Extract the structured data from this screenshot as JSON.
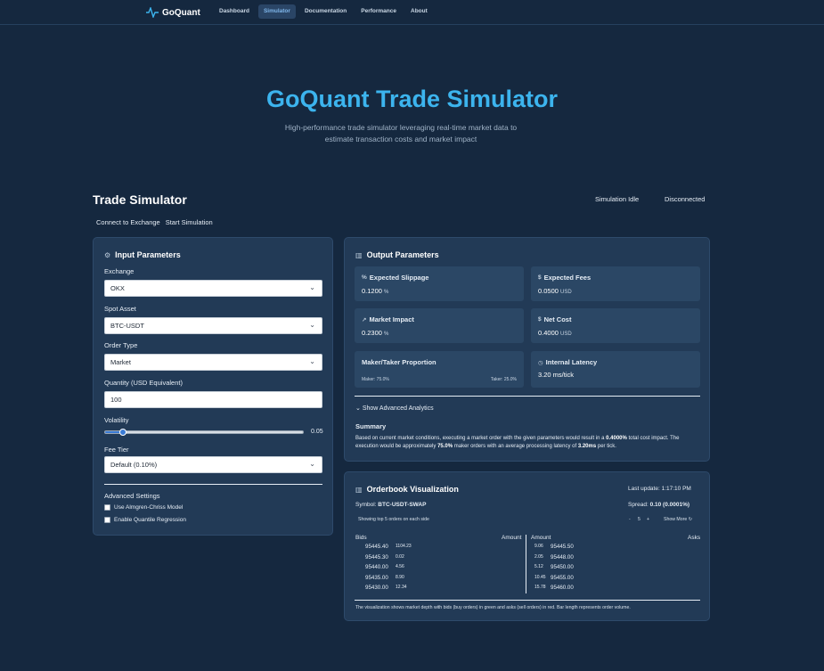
{
  "nav": {
    "brand": "GoQuant",
    "items": [
      "Dashboard",
      "Simulator",
      "Documentation",
      "Performance",
      "About"
    ],
    "active": "Simulator"
  },
  "hero": {
    "title": "GoQuant Trade Simulator",
    "subtitle_line1": "High-performance trade simulator leveraging real-time market data to",
    "subtitle_line2": "estimate transaction costs and market impact"
  },
  "simulator": {
    "title": "Trade Simulator",
    "status_sim": "Simulation Idle",
    "status_conn": "Disconnected",
    "connect_label": "Connect to Exchange",
    "start_label": "Start Simulation"
  },
  "inputs": {
    "title": "Input Parameters",
    "exchange_label": "Exchange",
    "exchange_value": "OKX",
    "asset_label": "Spot Asset",
    "asset_value": "BTC-USDT",
    "order_type_label": "Order Type",
    "order_type_value": "Market",
    "quantity_label": "Quantity (USD Equivalent)",
    "quantity_value": "100",
    "volatility_label": "Volatility",
    "volatility_value": "0.05",
    "volatility_fraction": 0.09,
    "fee_tier_label": "Fee Tier",
    "fee_tier_value": "Default (0.10%)",
    "advanced_label": "Advanced Settings",
    "almgren_label": "Use Almgren-Chriss Model",
    "quantile_label": "Enable Quantile Regression"
  },
  "outputs": {
    "title": "Output Parameters",
    "slippage_label": "Expected Slippage",
    "slippage_value": "0.1200",
    "slippage_unit": "%",
    "fees_label": "Expected Fees",
    "fees_value": "0.0500",
    "fees_unit": "USD",
    "impact_label": "Market Impact",
    "impact_value": "0.2300",
    "impact_unit": "%",
    "net_label": "Net Cost",
    "net_value": "0.4000",
    "net_unit": "USD",
    "maker_taker_label": "Maker/Taker Proportion",
    "maker_text": "Maker: 75.0%",
    "taker_text": "Taker: 25.0%",
    "latency_label": "Internal Latency",
    "latency_value": "3.20 ms/tick",
    "advanced_toggle": "Show Advanced Analytics",
    "summary_title": "Summary",
    "summary_p1": "Based on current market conditions, executing a market order with the given parameters would result in a ",
    "summary_b1": "0.4000%",
    "summary_p2": " total cost impact. The execution would be approximately ",
    "summary_b2": "75.0%",
    "summary_p3": " maker orders with an average processing latency of ",
    "summary_b3": "3.20ms",
    "summary_p4": " per tick."
  },
  "orderbook": {
    "title": "Orderbook Visualization",
    "last_update": "Last update: 1:17:10 PM",
    "symbol_label": "Symbol:",
    "symbol_value": "BTC-USDT-SWAP",
    "spread_label": "Spread:",
    "spread_value": "0.10 (0.0001%)",
    "showing_text": "Showing top 5 orders on each side",
    "minus": "-",
    "count": "5",
    "plus": "+",
    "show_more": "Show More",
    "bids_header": "Bids",
    "amount_header_left": "Amount",
    "amount_header_right": "Amount",
    "asks_header": "Asks",
    "bids": [
      {
        "price": "95445.40",
        "amount": "1104.23"
      },
      {
        "price": "95445.30",
        "amount": "0.02"
      },
      {
        "price": "95440.00",
        "amount": "4.56"
      },
      {
        "price": "95435.00",
        "amount": "8.90"
      },
      {
        "price": "95430.00",
        "amount": "12.34"
      }
    ],
    "asks": [
      {
        "amount": "9.06",
        "price": "95445.50"
      },
      {
        "amount": "2.05",
        "price": "95448.00"
      },
      {
        "amount": "5.12",
        "price": "95450.00"
      },
      {
        "amount": "10.45",
        "price": "95455.00"
      },
      {
        "amount": "15.78",
        "price": "95460.00"
      }
    ],
    "footnote": "The visualization shows market depth with bids (buy orders) in green and asks (sell orders) in red. Bar length represents order volume."
  }
}
